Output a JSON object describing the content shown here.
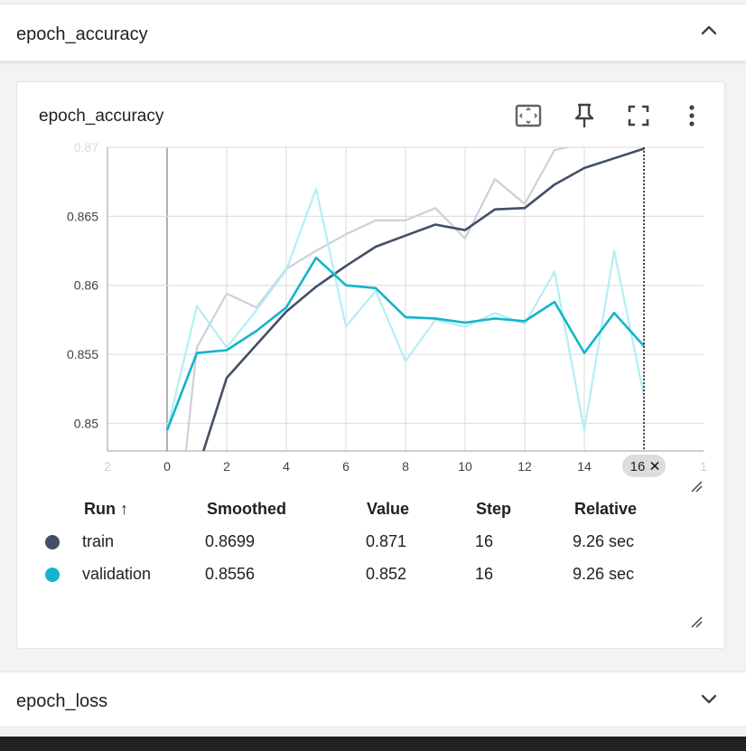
{
  "sections": {
    "accuracy_header": "epoch_accuracy",
    "loss_header": "epoch_loss"
  },
  "card": {
    "title": "epoch_accuracy"
  },
  "table": {
    "headers": [
      "Run ↑",
      "Smoothed",
      "Value",
      "Step",
      "Relative"
    ],
    "rows": [
      {
        "run": "train",
        "smoothed": "0.8699",
        "value": "0.871",
        "step": "16",
        "relative": "9.26 sec",
        "color": "#425066"
      },
      {
        "run": "validation",
        "smoothed": "0.8556",
        "value": "0.852",
        "step": "16",
        "relative": "9.26 sec",
        "color": "#12b5cb"
      }
    ]
  },
  "chart_data": {
    "type": "line",
    "title": "epoch_accuracy",
    "xlabel": "",
    "ylabel": "",
    "x_ticks": [
      "2",
      "0",
      "2",
      "4",
      "6",
      "8",
      "10",
      "12",
      "14",
      "16",
      "1"
    ],
    "y_ticks": [
      "0.85",
      "0.855",
      "0.86",
      "0.865",
      "0.87"
    ],
    "xlim": [
      -2,
      18
    ],
    "ylim": [
      0.848,
      0.87
    ],
    "grid": true,
    "hover_step": "16",
    "hover_label": "16",
    "series": [
      {
        "name": "train",
        "kind": "raw",
        "color": "#cdd0d8",
        "x": [
          0,
          1,
          2,
          3,
          4,
          5,
          6,
          7,
          8,
          9,
          10,
          11,
          12,
          13,
          14,
          15,
          16
        ],
        "y": [
          0.835,
          0.8555,
          0.8594,
          0.8584,
          0.8612,
          0.8625,
          0.8637,
          0.8647,
          0.8647,
          0.8656,
          0.8634,
          0.8677,
          0.8659,
          0.8698,
          0.8703,
          0.8708,
          0.871
        ]
      },
      {
        "name": "train",
        "kind": "smoothed",
        "color": "#425066",
        "x": [
          0,
          1,
          2,
          3,
          4,
          5,
          6,
          7,
          8,
          9,
          10,
          11,
          12,
          13,
          14,
          15,
          16
        ],
        "y": [
          0.83,
          0.8465,
          0.8533,
          0.8557,
          0.8581,
          0.8599,
          0.8614,
          0.8628,
          0.8636,
          0.8644,
          0.864,
          0.8655,
          0.8656,
          0.8673,
          0.8685,
          0.8692,
          0.8699
        ]
      },
      {
        "name": "validation",
        "kind": "raw",
        "color": "#b4eef5",
        "x": [
          0,
          1,
          2,
          3,
          4,
          5,
          6,
          7,
          8,
          9,
          10,
          11,
          12,
          13,
          14,
          15,
          16
        ],
        "y": [
          0.8495,
          0.8585,
          0.8555,
          0.8582,
          0.8611,
          0.867,
          0.857,
          0.8596,
          0.8545,
          0.8575,
          0.857,
          0.858,
          0.8572,
          0.861,
          0.8495,
          0.8625,
          0.852
        ]
      },
      {
        "name": "validation",
        "kind": "smoothed",
        "color": "#12b5cb",
        "x": [
          0,
          1,
          2,
          3,
          4,
          5,
          6,
          7,
          8,
          9,
          10,
          11,
          12,
          13,
          14,
          15,
          16
        ],
        "y": [
          0.8495,
          0.8551,
          0.8553,
          0.8567,
          0.8584,
          0.862,
          0.86,
          0.8598,
          0.8577,
          0.8576,
          0.8573,
          0.8576,
          0.8574,
          0.8588,
          0.8551,
          0.858,
          0.8556
        ]
      }
    ]
  }
}
